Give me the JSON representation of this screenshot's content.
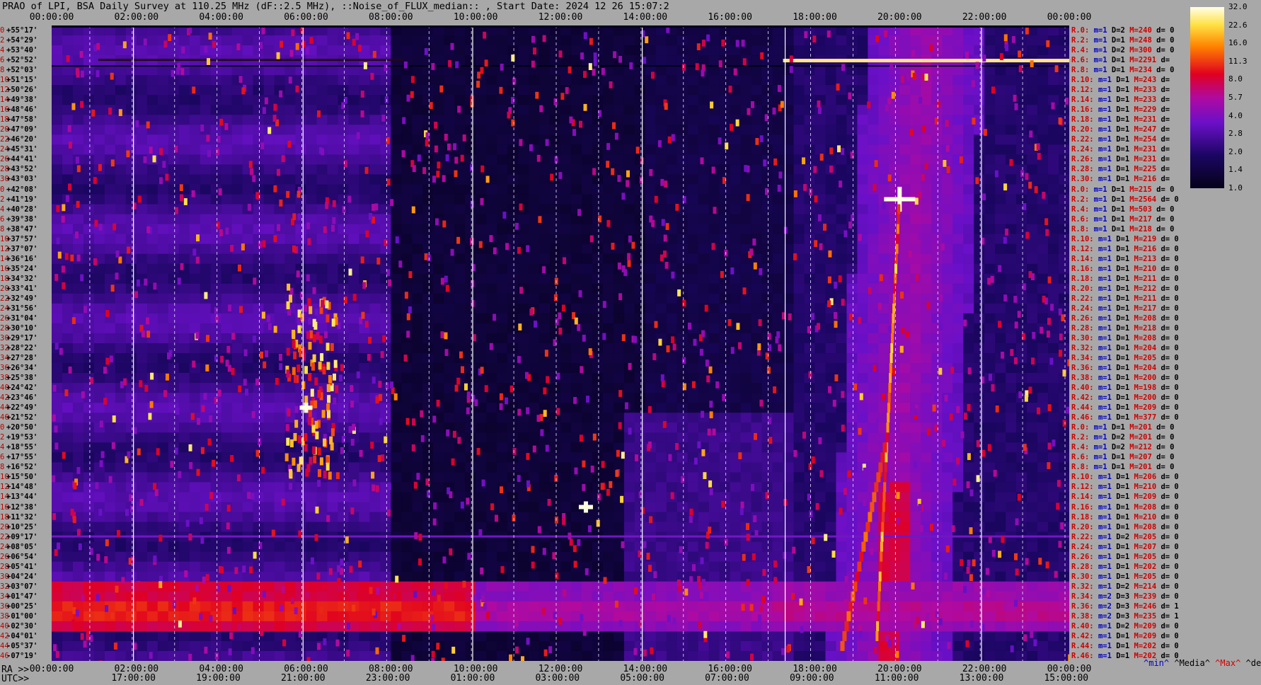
{
  "title": "PRAO of LPI, BSA Daily Survey at 110.25 MHz (dF::2.5 MHz), ::Noise_of_FLUX_median:: , Start Date: 2024 12 26 15:07:2",
  "ra_prefix": "RA >>",
  "utc_prefix": "UTC>>",
  "colors": {
    "background": "#a8a8a8",
    "low": "#06021a",
    "mid": "#7a10c8",
    "high": "#e00020",
    "peak": "#ffffc0"
  },
  "chart_data": {
    "type": "heatmap",
    "title": "PRAO of LPI, BSA Daily Survey at 110.25 MHz (dF::2.5 MHz), ::Noise_of_FLUX_median:: , Start Date: 2024 12 26 15:07:2",
    "x_top_ticks": [
      "00:00:00",
      "02:00:00",
      "04:00:00",
      "06:00:00",
      "08:00:00",
      "10:00:00",
      "12:00:00",
      "14:00:00",
      "16:00:00",
      "18:00:00",
      "20:00:00",
      "22:00:00",
      "00:00:00"
    ],
    "x_ra_ticks": [
      "00:00:00",
      "02:00:00",
      "04:00:00",
      "06:00:00",
      "08:00:00",
      "10:00:00",
      "12:00:00",
      "14:00:00",
      "16:00:00",
      "18:00:00",
      "20:00:00",
      "22:00:00",
      "00:00:00"
    ],
    "x_utc_ticks": [
      "17:00:00",
      "19:00:00",
      "21:00:00",
      "23:00:00",
      "01:00:00",
      "03:00:00",
      "05:00:00",
      "07:00:00",
      "09:00:00",
      "11:00:00",
      "13:00:00",
      "15:00:00"
    ],
    "y_declinations": [
      "+55°17'",
      "+54°29'",
      "+53°40'",
      "+52°52'",
      "+52°03'",
      "+51°15'",
      "+50°26'",
      "+49°38'",
      "+48°46'",
      "+47°58'",
      "+47°09'",
      "+46°20'",
      "+45°31'",
      "+44°41'",
      "+43°52'",
      "+43°03'",
      "+42°08'",
      "+41°19'",
      "+40°28'",
      "+39°38'",
      "+38°47'",
      "+37°57'",
      "+37°07'",
      "+36°16'",
      "+35°24'",
      "+34°32'",
      "+33°41'",
      "+32°49'",
      "+31°56'",
      "+31°04'",
      "+30°10'",
      "+29°17'",
      "+28°22'",
      "+27°28'",
      "+26°34'",
      "+25°38'",
      "+24°42'",
      "+23°46'",
      "+22°49'",
      "+21°52'",
      "+20°50'",
      "+19°53'",
      "+18°55'",
      "+17°55'",
      "+16°52'",
      "+15°50'",
      "+14°48'",
      "+13°44'",
      "+12°38'",
      "+11°32'",
      "+10°25'",
      "+09°17'",
      "+08°05'",
      "+06°54'",
      "+05°41'",
      "+04°24'",
      "+03°07'",
      "+01°47'",
      "+00°25'",
      "-01°00'",
      "-02°30'",
      "-04°01'",
      "-05°37'",
      "-07°19'"
    ],
    "y_index": [
      "0",
      "2",
      "4",
      "6",
      "8",
      "10",
      "12",
      "14",
      "16",
      "18",
      "20",
      "22",
      "24",
      "26",
      "28",
      "30",
      "0",
      "2",
      "4",
      "6",
      "8",
      "10",
      "12",
      "14",
      "16",
      "18",
      "20",
      "22",
      "24",
      "26",
      "28",
      "30",
      "32",
      "34",
      "36",
      "38",
      "40",
      "42",
      "44",
      "46",
      "0",
      "2",
      "4",
      "6",
      "8",
      "10",
      "12",
      "14",
      "16",
      "18",
      "20",
      "22",
      "24",
      "26",
      "28",
      "30",
      "32",
      "34",
      "36",
      "38",
      "40",
      "42",
      "44",
      "46"
    ],
    "colorbar": {
      "ticks": [
        "32.0",
        "22.6",
        "16.0",
        "11.3",
        "8.0",
        "5.7",
        "4.0",
        "2.8",
        "2.0",
        "1.4",
        "1.0"
      ],
      "range": [
        1.0,
        32.0
      ],
      "scale": "log"
    },
    "beam_stats": [
      {
        "r": "R.0:",
        "m": "m=1",
        "d": "D=2",
        "M": "M=240",
        "dev": "d= 0"
      },
      {
        "r": "R.2:",
        "m": "m=1",
        "d": "D=1",
        "M": "M=248",
        "dev": "d= 0"
      },
      {
        "r": "R.4:",
        "m": "m=1",
        "d": "D=2",
        "M": "M=300",
        "dev": "d= 0"
      },
      {
        "r": "R.6:",
        "m": "m=1",
        "d": "D=1",
        "M": "M=2291",
        "dev": "d="
      },
      {
        "r": "R.8:",
        "m": "m=1",
        "d": "D=1",
        "M": "M=234",
        "dev": "d= 0"
      },
      {
        "r": "R.10:",
        "m": "m=1",
        "d": "D=1",
        "M": "M=243",
        "dev": "d="
      },
      {
        "r": "R.12:",
        "m": "m=1",
        "d": "D=1",
        "M": "M=233",
        "dev": "d="
      },
      {
        "r": "R.14:",
        "m": "m=1",
        "d": "D=1",
        "M": "M=233",
        "dev": "d="
      },
      {
        "r": "R.16:",
        "m": "m=1",
        "d": "D=1",
        "M": "M=229",
        "dev": "d="
      },
      {
        "r": "R.18:",
        "m": "m=1",
        "d": "D=1",
        "M": "M=231",
        "dev": "d="
      },
      {
        "r": "R.20:",
        "m": "m=1",
        "d": "D=1",
        "M": "M=247",
        "dev": "d="
      },
      {
        "r": "R.22:",
        "m": "m=1",
        "d": "D=1",
        "M": "M=254",
        "dev": "d="
      },
      {
        "r": "R.24:",
        "m": "m=1",
        "d": "D=1",
        "M": "M=231",
        "dev": "d="
      },
      {
        "r": "R.26:",
        "m": "m=1",
        "d": "D=1",
        "M": "M=231",
        "dev": "d="
      },
      {
        "r": "R.28:",
        "m": "m=1",
        "d": "D=1",
        "M": "M=225",
        "dev": "d="
      },
      {
        "r": "R.30:",
        "m": "m=1",
        "d": "D=1",
        "M": "M=216",
        "dev": "d="
      },
      {
        "r": "R.0:",
        "m": "m=1",
        "d": "D=1",
        "M": "M=215",
        "dev": "d= 0"
      },
      {
        "r": "R.2:",
        "m": "m=1",
        "d": "D=1",
        "M": "M=2564",
        "dev": "d= 0"
      },
      {
        "r": "R.4:",
        "m": "m=1",
        "d": "D=1",
        "M": "M=503",
        "dev": "d= 0"
      },
      {
        "r": "R.6:",
        "m": "m=1",
        "d": "D=1",
        "M": "M=217",
        "dev": "d= 0"
      },
      {
        "r": "R.8:",
        "m": "m=1",
        "d": "D=1",
        "M": "M=218",
        "dev": "d= 0"
      },
      {
        "r": "R.10:",
        "m": "m=1",
        "d": "D=1",
        "M": "M=219",
        "dev": "d= 0"
      },
      {
        "r": "R.12:",
        "m": "m=1",
        "d": "D=1",
        "M": "M=216",
        "dev": "d= 0"
      },
      {
        "r": "R.14:",
        "m": "m=1",
        "d": "D=1",
        "M": "M=213",
        "dev": "d= 0"
      },
      {
        "r": "R.16:",
        "m": "m=1",
        "d": "D=1",
        "M": "M=210",
        "dev": "d= 0"
      },
      {
        "r": "R.18:",
        "m": "m=1",
        "d": "D=1",
        "M": "M=211",
        "dev": "d= 0"
      },
      {
        "r": "R.20:",
        "m": "m=1",
        "d": "D=1",
        "M": "M=212",
        "dev": "d= 0"
      },
      {
        "r": "R.22:",
        "m": "m=1",
        "d": "D=1",
        "M": "M=211",
        "dev": "d= 0"
      },
      {
        "r": "R.24:",
        "m": "m=1",
        "d": "D=1",
        "M": "M=217",
        "dev": "d= 0"
      },
      {
        "r": "R.26:",
        "m": "m=1",
        "d": "D=1",
        "M": "M=208",
        "dev": "d= 0"
      },
      {
        "r": "R.28:",
        "m": "m=1",
        "d": "D=1",
        "M": "M=218",
        "dev": "d= 0"
      },
      {
        "r": "R.30:",
        "m": "m=1",
        "d": "D=1",
        "M": "M=208",
        "dev": "d= 0"
      },
      {
        "r": "R.32:",
        "m": "m=1",
        "d": "D=1",
        "M": "M=204",
        "dev": "d= 0"
      },
      {
        "r": "R.34:",
        "m": "m=1",
        "d": "D=1",
        "M": "M=205",
        "dev": "d= 0"
      },
      {
        "r": "R.36:",
        "m": "m=1",
        "d": "D=1",
        "M": "M=204",
        "dev": "d= 0"
      },
      {
        "r": "R.38:",
        "m": "m=1",
        "d": "D=1",
        "M": "M=200",
        "dev": "d= 0"
      },
      {
        "r": "R.40:",
        "m": "m=1",
        "d": "D=1",
        "M": "M=198",
        "dev": "d= 0"
      },
      {
        "r": "R.42:",
        "m": "m=1",
        "d": "D=1",
        "M": "M=200",
        "dev": "d= 0"
      },
      {
        "r": "R.44:",
        "m": "m=1",
        "d": "D=1",
        "M": "M=209",
        "dev": "d= 0"
      },
      {
        "r": "R.46:",
        "m": "m=1",
        "d": "D=1",
        "M": "M=377",
        "dev": "d= 0"
      },
      {
        "r": "R.0:",
        "m": "m=1",
        "d": "D=1",
        "M": "M=201",
        "dev": "d= 0"
      },
      {
        "r": "R.2:",
        "m": "m=1",
        "d": "D=2",
        "M": "M=201",
        "dev": "d= 0"
      },
      {
        "r": "R.4:",
        "m": "m=1",
        "d": "D=2",
        "M": "M=212",
        "dev": "d= 0"
      },
      {
        "r": "R.6:",
        "m": "m=1",
        "d": "D=1",
        "M": "M=207",
        "dev": "d= 0"
      },
      {
        "r": "R.8:",
        "m": "m=1",
        "d": "D=1",
        "M": "M=201",
        "dev": "d= 0"
      },
      {
        "r": "R.10:",
        "m": "m=1",
        "d": "D=1",
        "M": "M=206",
        "dev": "d= 0"
      },
      {
        "r": "R.12:",
        "m": "m=1",
        "d": "D=1",
        "M": "M=210",
        "dev": "d= 0"
      },
      {
        "r": "R.14:",
        "m": "m=1",
        "d": "D=1",
        "M": "M=209",
        "dev": "d= 0"
      },
      {
        "r": "R.16:",
        "m": "m=1",
        "d": "D=1",
        "M": "M=208",
        "dev": "d= 0"
      },
      {
        "r": "R.18:",
        "m": "m=1",
        "d": "D=1",
        "M": "M=210",
        "dev": "d= 0"
      },
      {
        "r": "R.20:",
        "m": "m=1",
        "d": "D=1",
        "M": "M=208",
        "dev": "d= 0"
      },
      {
        "r": "R.22:",
        "m": "m=1",
        "d": "D=2",
        "M": "M=205",
        "dev": "d= 0"
      },
      {
        "r": "R.24:",
        "m": "m=1",
        "d": "D=1",
        "M": "M=207",
        "dev": "d= 0"
      },
      {
        "r": "R.26:",
        "m": "m=1",
        "d": "D=1",
        "M": "M=205",
        "dev": "d= 0"
      },
      {
        "r": "R.28:",
        "m": "m=1",
        "d": "D=1",
        "M": "M=202",
        "dev": "d= 0"
      },
      {
        "r": "R.30:",
        "m": "m=1",
        "d": "D=1",
        "M": "M=205",
        "dev": "d= 0"
      },
      {
        "r": "R.32:",
        "m": "m=1",
        "d": "D=2",
        "M": "M=214",
        "dev": "d= 0"
      },
      {
        "r": "R.34:",
        "m": "m=2",
        "d": "D=3",
        "M": "M=239",
        "dev": "d= 0"
      },
      {
        "r": "R.36:",
        "m": "m=2",
        "d": "D=3",
        "M": "M=246",
        "dev": "d= 1"
      },
      {
        "r": "R.38:",
        "m": "m=2",
        "d": "D=3",
        "M": "M=235",
        "dev": "d= 1"
      },
      {
        "r": "R.40:",
        "m": "m=1",
        "d": "D=2",
        "M": "M=209",
        "dev": "d= 0"
      },
      {
        "r": "R.42:",
        "m": "m=1",
        "d": "D=1",
        "M": "M=209",
        "dev": "d= 0"
      },
      {
        "r": "R.44:",
        "m": "m=1",
        "d": "D=1",
        "M": "M=202",
        "dev": "d= 0"
      },
      {
        "r": "R.46:",
        "m": "m=1",
        "d": "D=1",
        "M": "M=202",
        "dev": "d= 0"
      }
    ],
    "legend": {
      "min": "^min^",
      "median": "^Media^",
      "max": "^Max^",
      "dev": "^devia^"
    },
    "features": [
      {
        "name": "galactic-plane-band",
        "dec": "-01°00'",
        "ra": "00:00-24:00"
      },
      {
        "name": "rfi-streak",
        "dec": "+52°52'",
        "ra": "17:00-24:00"
      },
      {
        "name": "bright-source",
        "dec": "+41°19'",
        "ra": "20:00"
      },
      {
        "name": "galactic-arc",
        "dec_range": "-07°19' to +55°17'",
        "ra_range": "18:30-21:30"
      }
    ]
  }
}
